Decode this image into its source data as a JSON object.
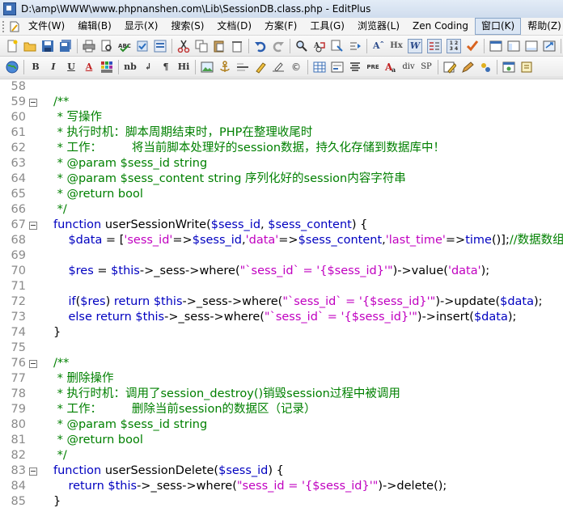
{
  "window": {
    "title": "D:\\amp\\WWW\\www.phpnanshen.com\\Lib\\SessionDB.class.php - EditPlus"
  },
  "menu": {
    "items": [
      {
        "label": "文件(W)"
      },
      {
        "label": "编辑(B)"
      },
      {
        "label": "显示(X)"
      },
      {
        "label": "搜索(S)"
      },
      {
        "label": "文档(D)"
      },
      {
        "label": "方案(F)"
      },
      {
        "label": "工具(G)"
      },
      {
        "label": "浏览器(L)"
      },
      {
        "label": "Zen Coding"
      },
      {
        "label": "窗口(K)"
      },
      {
        "label": "帮助(Z)"
      }
    ]
  },
  "toolbar2_labels": {
    "bold": "B",
    "italic": "I",
    "underline": "U",
    "font_color": "A",
    "nbsp": "nb",
    "br": "↲",
    "para": "¶",
    "heading": "Hi",
    "pre": "PRE",
    "div": "div",
    "span": "SP"
  },
  "toolbar1_labels": {
    "font_size": "Aˆ",
    "hex": "Hx",
    "wrap": "W"
  },
  "editor": {
    "lines": [
      {
        "n": "58",
        "fold": false,
        "segs": []
      },
      {
        "n": "59",
        "fold": true,
        "segs": [
          {
            "t": "cm",
            "x": "/**"
          }
        ]
      },
      {
        "n": "60",
        "fold": false,
        "segs": [
          {
            "t": "cm",
            "x": " * 写操作"
          }
        ]
      },
      {
        "n": "61",
        "fold": false,
        "segs": [
          {
            "t": "cm",
            "x": " * 执行时机：脚本周期结束时，PHP在整理收尾时"
          }
        ]
      },
      {
        "n": "62",
        "fold": false,
        "segs": [
          {
            "t": "cm",
            "x": " * 工作：        将当前脚本处理好的session数据，持久化存储到数据库中！"
          }
        ]
      },
      {
        "n": "63",
        "fold": false,
        "segs": [
          {
            "t": "cm",
            "x": " * @param $sess_id string"
          }
        ]
      },
      {
        "n": "64",
        "fold": false,
        "segs": [
          {
            "t": "cm",
            "x": " * @param $sess_content string 序列化好的session内容字符串"
          }
        ]
      },
      {
        "n": "65",
        "fold": false,
        "segs": [
          {
            "t": "cm",
            "x": " * @return bool"
          }
        ]
      },
      {
        "n": "66",
        "fold": false,
        "segs": [
          {
            "t": "cm",
            "x": " */"
          }
        ]
      },
      {
        "n": "67",
        "fold": true,
        "segs": [
          {
            "t": "kw",
            "x": "function "
          },
          {
            "t": "pl",
            "x": "userSessionWrite("
          },
          {
            "t": "var",
            "x": "$sess_id"
          },
          {
            "t": "pl",
            "x": ", "
          },
          {
            "t": "var",
            "x": "$sess_content"
          },
          {
            "t": "pl",
            "x": ") {"
          }
        ]
      },
      {
        "n": "68",
        "fold": false,
        "segs": [
          {
            "t": "pl",
            "x": "    "
          },
          {
            "t": "var",
            "x": "$data"
          },
          {
            "t": "pl",
            "x": " = ["
          },
          {
            "t": "str",
            "x": "'sess_id'"
          },
          {
            "t": "pl",
            "x": "=>"
          },
          {
            "t": "var",
            "x": "$sess_id"
          },
          {
            "t": "pl",
            "x": ","
          },
          {
            "t": "str",
            "x": "'data'"
          },
          {
            "t": "pl",
            "x": "=>"
          },
          {
            "t": "var",
            "x": "$sess_content"
          },
          {
            "t": "pl",
            "x": ","
          },
          {
            "t": "str",
            "x": "'last_time'"
          },
          {
            "t": "pl",
            "x": "=>"
          },
          {
            "t": "fn",
            "x": "time"
          },
          {
            "t": "pl",
            "x": "()];"
          },
          {
            "t": "cm",
            "x": "//数据数组"
          }
        ]
      },
      {
        "n": "69",
        "fold": false,
        "segs": []
      },
      {
        "n": "70",
        "fold": false,
        "segs": [
          {
            "t": "pl",
            "x": "    "
          },
          {
            "t": "var",
            "x": "$res"
          },
          {
            "t": "pl",
            "x": " = "
          },
          {
            "t": "var",
            "x": "$this"
          },
          {
            "t": "pl",
            "x": "->_sess->where("
          },
          {
            "t": "str",
            "x": "\"`sess_id` = '{$sess_id}'\""
          },
          {
            "t": "pl",
            "x": ")->value("
          },
          {
            "t": "str",
            "x": "'data'"
          },
          {
            "t": "pl",
            "x": ");"
          }
        ]
      },
      {
        "n": "71",
        "fold": false,
        "segs": []
      },
      {
        "n": "72",
        "fold": false,
        "segs": [
          {
            "t": "pl",
            "x": "    "
          },
          {
            "t": "kw",
            "x": "if"
          },
          {
            "t": "pl",
            "x": "("
          },
          {
            "t": "var",
            "x": "$res"
          },
          {
            "t": "pl",
            "x": ") "
          },
          {
            "t": "kw",
            "x": "return "
          },
          {
            "t": "var",
            "x": "$this"
          },
          {
            "t": "pl",
            "x": "->_sess->where("
          },
          {
            "t": "str",
            "x": "\"`sess_id` = '{$sess_id}'\""
          },
          {
            "t": "pl",
            "x": ")->update("
          },
          {
            "t": "var",
            "x": "$data"
          },
          {
            "t": "pl",
            "x": ");"
          }
        ]
      },
      {
        "n": "73",
        "fold": false,
        "segs": [
          {
            "t": "pl",
            "x": "    "
          },
          {
            "t": "kw",
            "x": "else return "
          },
          {
            "t": "var",
            "x": "$this"
          },
          {
            "t": "pl",
            "x": "->_sess->where("
          },
          {
            "t": "str",
            "x": "\"`sess_id` = '{$sess_id}'\""
          },
          {
            "t": "pl",
            "x": ")->insert("
          },
          {
            "t": "var",
            "x": "$data"
          },
          {
            "t": "pl",
            "x": ");"
          }
        ]
      },
      {
        "n": "74",
        "fold": false,
        "segs": [
          {
            "t": "pl",
            "x": "}"
          }
        ]
      },
      {
        "n": "75",
        "fold": false,
        "segs": []
      },
      {
        "n": "76",
        "fold": true,
        "segs": [
          {
            "t": "cm",
            "x": "/**"
          }
        ]
      },
      {
        "n": "77",
        "fold": false,
        "segs": [
          {
            "t": "cm",
            "x": " * 删除操作"
          }
        ]
      },
      {
        "n": "78",
        "fold": false,
        "segs": [
          {
            "t": "cm",
            "x": " * 执行时机：调用了session_destroy()销毁session过程中被调用"
          }
        ]
      },
      {
        "n": "79",
        "fold": false,
        "segs": [
          {
            "t": "cm",
            "x": " * 工作：        删除当前session的数据区（记录）"
          }
        ]
      },
      {
        "n": "80",
        "fold": false,
        "segs": [
          {
            "t": "cm",
            "x": " * @param $sess_id string"
          }
        ]
      },
      {
        "n": "81",
        "fold": false,
        "segs": [
          {
            "t": "cm",
            "x": " * @return bool"
          }
        ]
      },
      {
        "n": "82",
        "fold": false,
        "segs": [
          {
            "t": "cm",
            "x": " */"
          }
        ]
      },
      {
        "n": "83",
        "fold": true,
        "segs": [
          {
            "t": "kw",
            "x": "function "
          },
          {
            "t": "pl",
            "x": "userSessionDelete("
          },
          {
            "t": "var",
            "x": "$sess_id"
          },
          {
            "t": "pl",
            "x": ") {"
          }
        ]
      },
      {
        "n": "84",
        "fold": false,
        "segs": [
          {
            "t": "pl",
            "x": "    "
          },
          {
            "t": "kw",
            "x": "return "
          },
          {
            "t": "var",
            "x": "$this"
          },
          {
            "t": "pl",
            "x": "->_sess->where("
          },
          {
            "t": "str",
            "x": "\"sess_id = '{$sess_id}'\""
          },
          {
            "t": "pl",
            "x": ")->delete();"
          }
        ]
      },
      {
        "n": "85",
        "fold": false,
        "segs": [
          {
            "t": "pl",
            "x": "}"
          }
        ]
      }
    ]
  },
  "colors": {
    "comment": "#008000",
    "keyword": "#0000c0",
    "string": "#c000c0",
    "line_number": "#8a8a8a"
  }
}
